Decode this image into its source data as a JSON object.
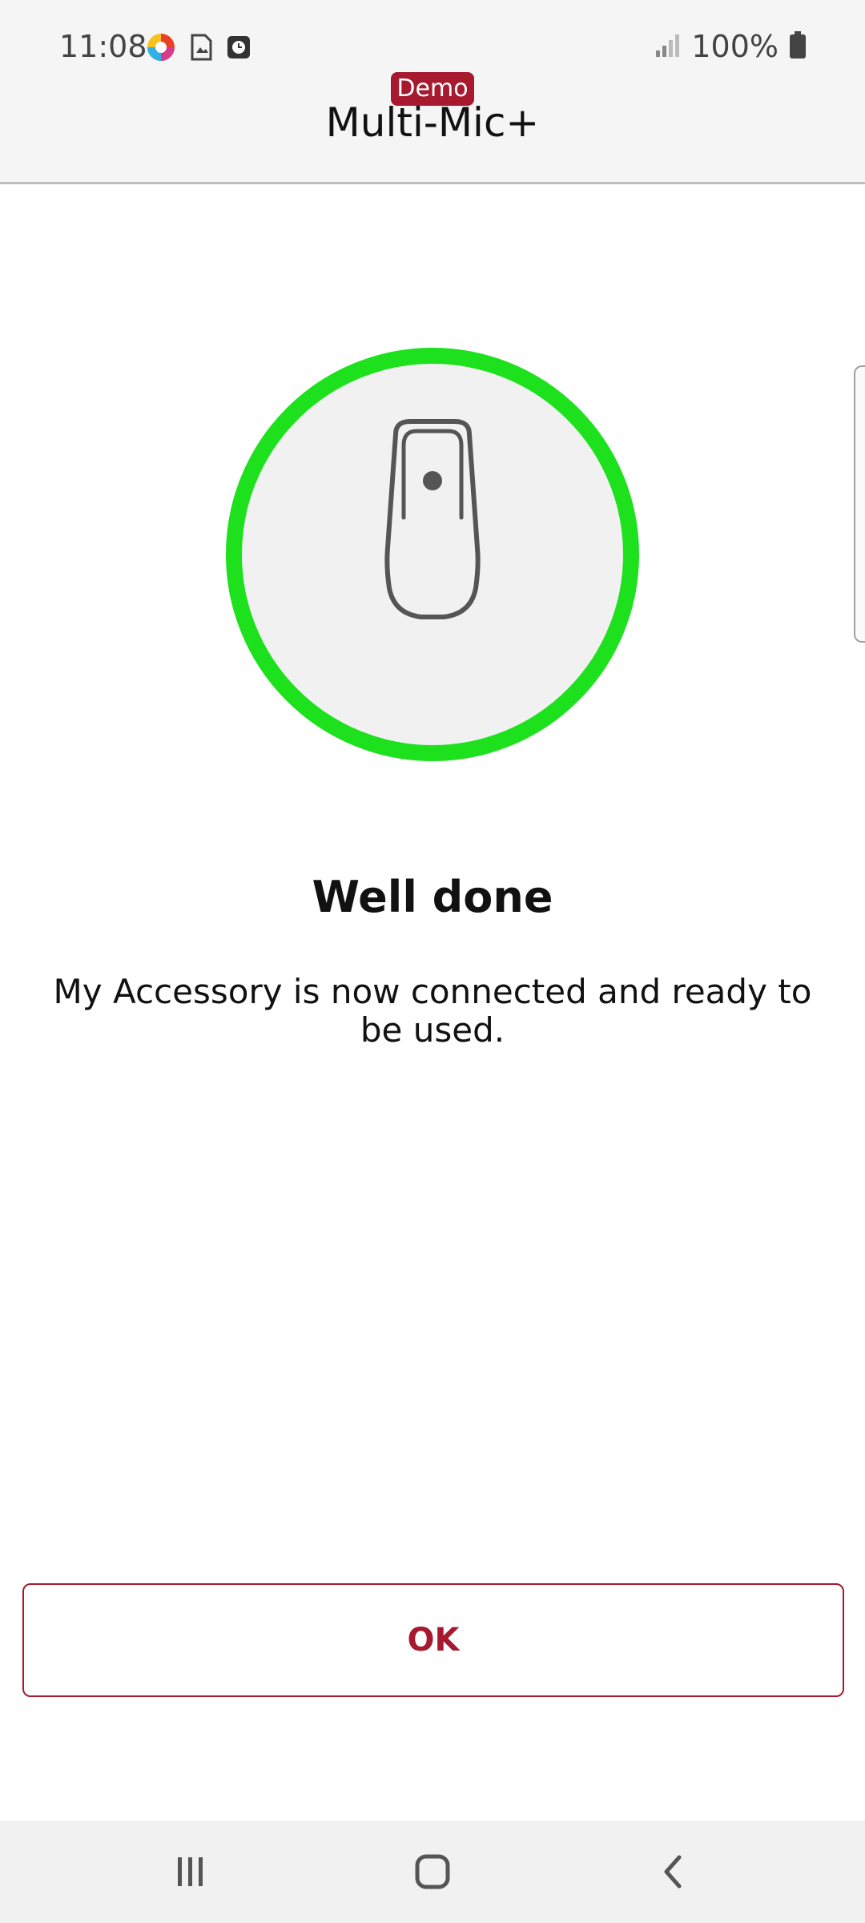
{
  "status": {
    "time": "11:08",
    "battery": "100%",
    "icons": [
      "assistant-app-icon",
      "image-file-icon",
      "clock-app-icon",
      "signal-icon",
      "battery-icon"
    ]
  },
  "header": {
    "badge": "Demo",
    "title": "Multi-Mic+"
  },
  "device": {
    "icon": "accessory-device-icon",
    "ring_color": "#1de11d"
  },
  "main": {
    "heading": "Well done",
    "message": "My Accessory is now connected and ready to be used."
  },
  "actions": {
    "ok_label": "OK"
  },
  "nav": {
    "icons": [
      "recent-apps-icon",
      "home-icon",
      "back-icon"
    ]
  },
  "colors": {
    "brand": "#a6192e",
    "success": "#1de11d"
  }
}
